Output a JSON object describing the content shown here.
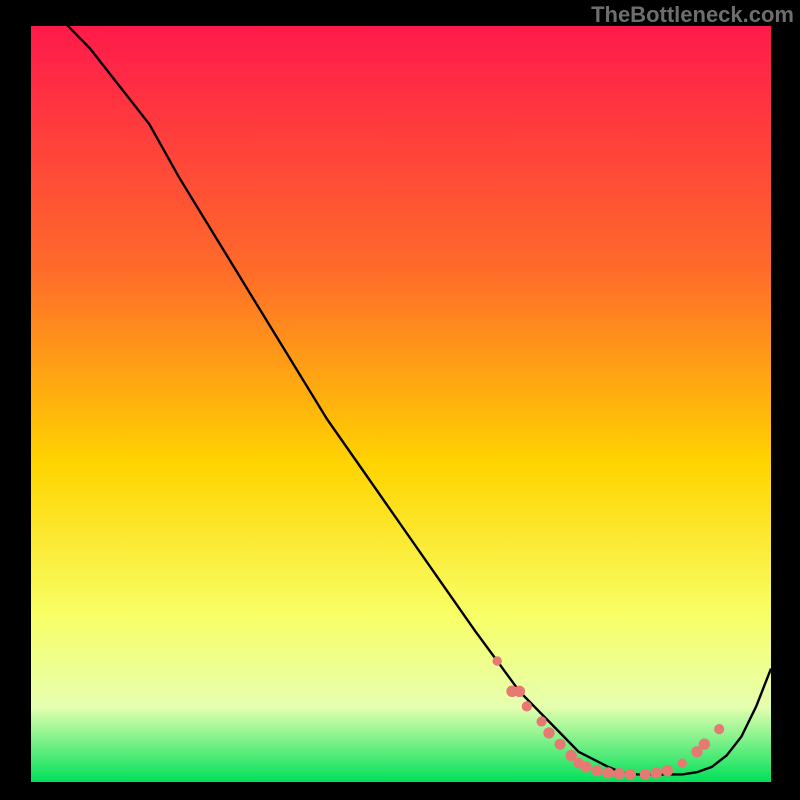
{
  "watermark": "TheBottleneck.com",
  "colors": {
    "grad_top": "#ff1a4b",
    "grad_upper": "#ff6a2a",
    "grad_mid": "#ffd400",
    "grad_low": "#f8ff66",
    "grad_pale": "#e6ffb0",
    "grad_bottom": "#00e05a",
    "curve": "#000000",
    "marker_fill": "#e67a73",
    "marker_stroke": "#e67a73"
  },
  "chart_data": {
    "type": "line",
    "title": "",
    "xlabel": "",
    "ylabel": "",
    "x_range": [
      0,
      100
    ],
    "y_range": [
      0,
      100
    ],
    "series": [
      {
        "name": "bottleneck-curve",
        "x": [
          0,
          4,
          8,
          12,
          16,
          20,
          25,
          30,
          35,
          40,
          45,
          50,
          55,
          60,
          63,
          66,
          69,
          72,
          74,
          76,
          78,
          80,
          82,
          84,
          86,
          88,
          90,
          92,
          94,
          96,
          98,
          100
        ],
        "y": [
          105,
          101,
          97,
          92,
          87,
          80,
          72,
          64,
          56,
          48,
          41,
          34,
          27,
          20,
          16,
          12,
          9,
          6,
          4,
          3,
          2,
          1.2,
          1,
          1,
          1,
          1,
          1.3,
          2,
          3.5,
          6,
          10,
          15
        ]
      }
    ],
    "markers": {
      "name": "valley-points",
      "points": [
        {
          "x": 63,
          "y": 16,
          "r": 4.2
        },
        {
          "x": 65,
          "y": 12,
          "r": 5.2
        },
        {
          "x": 66,
          "y": 12,
          "r": 5.2
        },
        {
          "x": 67,
          "y": 10,
          "r": 4.6
        },
        {
          "x": 69,
          "y": 8,
          "r": 4.6
        },
        {
          "x": 70,
          "y": 6.5,
          "r": 5.2
        },
        {
          "x": 71.5,
          "y": 5,
          "r": 5.0
        },
        {
          "x": 73,
          "y": 3.5,
          "r": 5.2
        },
        {
          "x": 74,
          "y": 2.5,
          "r": 4.8
        },
        {
          "x": 75,
          "y": 2,
          "r": 5.2
        },
        {
          "x": 76.5,
          "y": 1.5,
          "r": 5.2
        },
        {
          "x": 78,
          "y": 1.2,
          "r": 5.2
        },
        {
          "x": 79.5,
          "y": 1.1,
          "r": 5.2
        },
        {
          "x": 81,
          "y": 1,
          "r": 5.2
        },
        {
          "x": 83,
          "y": 1,
          "r": 5.0
        },
        {
          "x": 84.5,
          "y": 1.2,
          "r": 5.2
        },
        {
          "x": 86,
          "y": 1.5,
          "r": 5.2
        },
        {
          "x": 88,
          "y": 2.5,
          "r": 4.2
        },
        {
          "x": 90,
          "y": 4,
          "r": 5.2
        },
        {
          "x": 91,
          "y": 5,
          "r": 5.2
        },
        {
          "x": 93,
          "y": 7,
          "r": 4.6
        }
      ]
    }
  }
}
